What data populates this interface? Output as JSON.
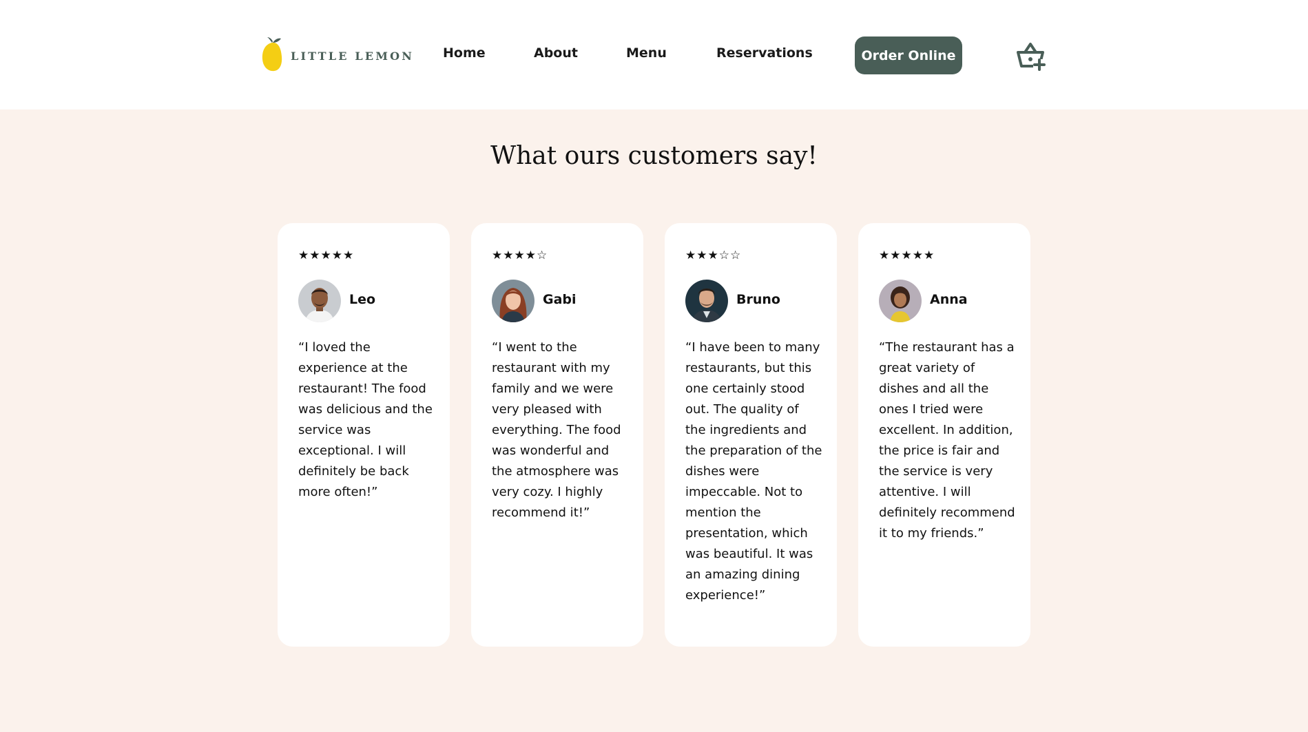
{
  "header": {
    "brand": "LITTLE LEMON",
    "nav": [
      "Home",
      "About",
      "Menu",
      "Reservations"
    ],
    "cta": "Order Online",
    "cart_icon": "basket-add-icon",
    "accent": "#495e57",
    "logo_color": "#f4ce14"
  },
  "section": {
    "title": "What ours customers say!",
    "background": "#fbf2ec"
  },
  "testimonials": [
    {
      "rating": 5,
      "stars": "★★★★★",
      "name": "Leo",
      "avatar": "avatar-photo-leo",
      "quote": "“I loved the experience at the restaurant! The food was delicious and the service was exceptional. I will definitely be back more often!”"
    },
    {
      "rating": 4,
      "stars": "★★★★☆",
      "name": "Gabi",
      "avatar": "avatar-photo-gabi",
      "quote": "“I went to the restaurant with my family and we were very pleased with everything. The food was wonderful and the atmosphere was very cozy. I highly recommend it!”"
    },
    {
      "rating": 3,
      "stars": "★★★☆☆",
      "name": "Bruno",
      "avatar": "avatar-photo-bruno",
      "quote": "“I have been to many restaurants, but this one certainly stood out. The quality of the ingredients and the preparation of the dishes were impeccable. Not to mention the presentation, which was beautiful. It was an amazing dining experience!”"
    },
    {
      "rating": 5,
      "stars": "★★★★★",
      "name": "Anna",
      "avatar": "avatar-photo-anna",
      "quote": "“The restaurant has a great variety of dishes and all the ones I tried were excellent. In addition, the price is fair and the service is very attentive. I will definitely recommend it to my friends.”"
    }
  ]
}
